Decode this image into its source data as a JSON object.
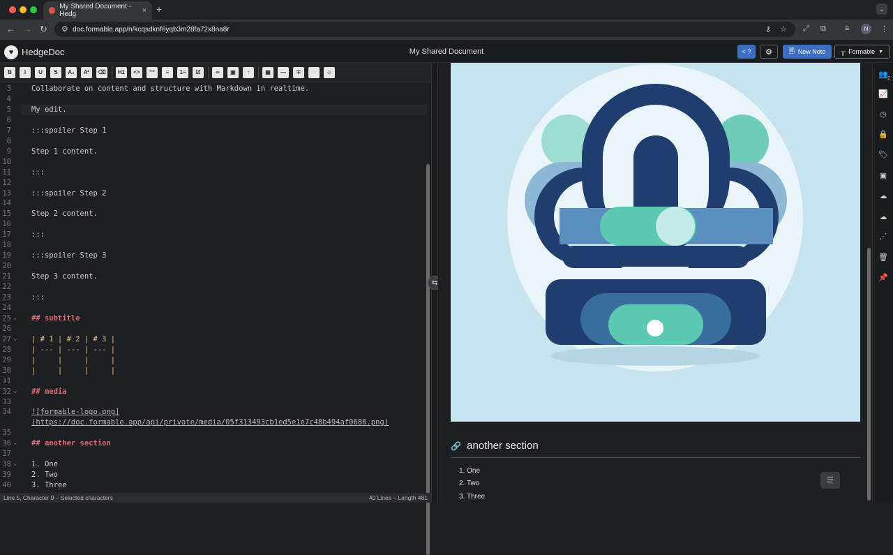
{
  "browser": {
    "tab_title": "My Shared Document - Hedg",
    "tab_close": "×",
    "new_tab": "+",
    "url": "doc.formable.app/n/kcqsdknf6yqb3m28fa72x8na8r",
    "avatar_letter": "N"
  },
  "app": {
    "brand": "HedgeDoc",
    "doc_title": "My Shared Document",
    "help_label": "< ?",
    "new_note_label": "New Note",
    "workspace_label": "Formable"
  },
  "toolbar": {
    "buttons": [
      "B",
      "I",
      "U",
      "S",
      "A₂",
      "A²",
      "⌫",
      "H1",
      "<>",
      "““",
      "≡",
      "1≡",
      "☑",
      "∞",
      "▣",
      "↑",
      "▦",
      "—",
      "∓",
      "◌",
      "☺"
    ]
  },
  "editor": {
    "lines": [
      {
        "n": "3",
        "t": "Collaborate on content and structure with Markdown in realtime."
      },
      {
        "n": "4",
        "t": ""
      },
      {
        "n": "5",
        "t": "My edit."
      },
      {
        "n": "6",
        "t": ""
      },
      {
        "n": "7",
        "t": ":::spoiler Step 1"
      },
      {
        "n": "8",
        "t": ""
      },
      {
        "n": "9",
        "t": "Step 1 content."
      },
      {
        "n": "10",
        "t": ""
      },
      {
        "n": "11",
        "t": ":::"
      },
      {
        "n": "12",
        "t": ""
      },
      {
        "n": "13",
        "t": ":::spoiler Step 2"
      },
      {
        "n": "14",
        "t": ""
      },
      {
        "n": "15",
        "t": "Step 2 content."
      },
      {
        "n": "16",
        "t": ""
      },
      {
        "n": "17",
        "t": ":::"
      },
      {
        "n": "18",
        "t": ""
      },
      {
        "n": "19",
        "t": ":::spoiler Step 3"
      },
      {
        "n": "20",
        "t": ""
      },
      {
        "n": "21",
        "t": "Step 3 content."
      },
      {
        "n": "22",
        "t": ""
      },
      {
        "n": "23",
        "t": ":::"
      },
      {
        "n": "24",
        "t": ""
      },
      {
        "n": "25",
        "t": "## subtitle",
        "kind": "heading"
      },
      {
        "n": "26",
        "t": ""
      },
      {
        "n": "27",
        "t": "| # 1 | # 2 | # 3 |",
        "kind": "table"
      },
      {
        "n": "28",
        "t": "| --- | --- | --- |",
        "kind": "table"
      },
      {
        "n": "29",
        "t": "|     |     |     |",
        "kind": "table"
      },
      {
        "n": "30",
        "t": "|     |     |     |",
        "kind": "table"
      },
      {
        "n": "31",
        "t": ""
      },
      {
        "n": "32",
        "t": "## media",
        "kind": "heading"
      },
      {
        "n": "33",
        "t": ""
      },
      {
        "n": "34",
        "t": "![formable-logo.png]",
        "kind": "link"
      },
      {
        "n": "",
        "t": "(https://doc.formable.app/api/private/media/05f313493cb1ed5e1e7c48b494af0686.png)",
        "kind": "link"
      },
      {
        "n": "35",
        "t": ""
      },
      {
        "n": "36",
        "t": "## another section",
        "kind": "heading"
      },
      {
        "n": "37",
        "t": ""
      },
      {
        "n": "38",
        "t": "1. One"
      },
      {
        "n": "39",
        "t": "2. Two"
      },
      {
        "n": "40",
        "t": "3. Three"
      }
    ]
  },
  "status": {
    "left": "Line 5, Character 9 – Selected characters",
    "right": "40 Lines – Length 481"
  },
  "preview": {
    "section_heading": "another section",
    "list": [
      "One",
      "Two",
      "Three"
    ],
    "colors": {
      "bg": "#c7e3ee",
      "navy": "#1f3e6e",
      "teal": "#5cc9b3",
      "light": "#eaf5f9"
    }
  },
  "rail": {
    "icons": [
      "users-icon",
      "chart-icon",
      "history-icon",
      "lock-icon",
      "tag-icon",
      "image-icon",
      "upload-cloud-icon",
      "download-cloud-icon",
      "share-icon",
      "trash-icon",
      "pin-icon"
    ],
    "users_count": "2"
  }
}
